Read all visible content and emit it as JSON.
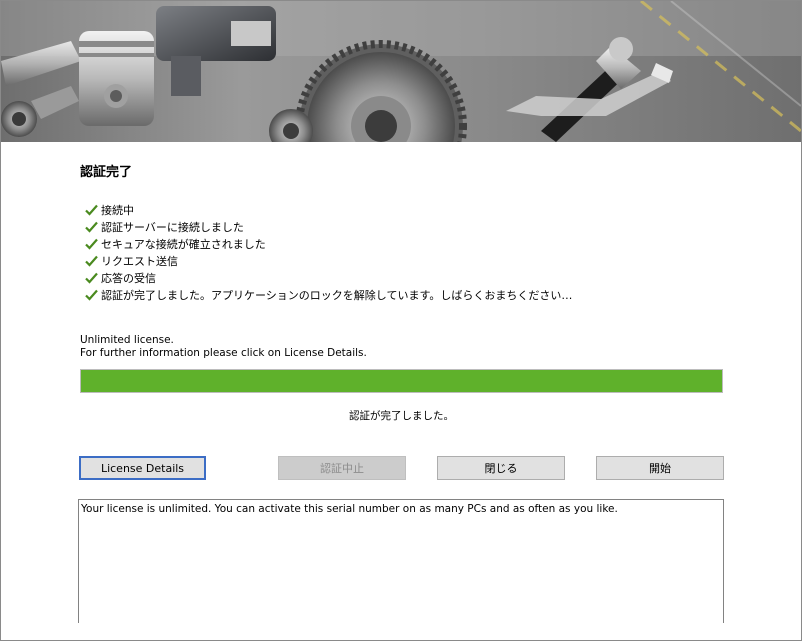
{
  "window": {
    "title": "認証完了"
  },
  "steps": [
    {
      "label": "接続中"
    },
    {
      "label": "認証サーバーに接続しました"
    },
    {
      "label": "セキュアな接続が確立されました"
    },
    {
      "label": "リクエスト送信"
    },
    {
      "label": "応答の受信"
    },
    {
      "label": "認証が完了しました。アプリケーションのロックを解除しています。しばらくおまちください…"
    }
  ],
  "license_info": {
    "line1": "Unlimited license.",
    "line2": "For further information please click on  License Details."
  },
  "progress": {
    "percent": 100,
    "color": "#5fb12b"
  },
  "status_text": "認証が完了しました。",
  "buttons": {
    "license_details": "License Details",
    "cancel_auth": "認証中止",
    "close": "閉じる",
    "start": "開始"
  },
  "details_text": "Your license is unlimited. You can activate this serial number on as many PCs and as often as you like.",
  "icons": {
    "step_check": "check-icon",
    "banner": "engine-parts-banner"
  },
  "colors": {
    "check": "#4a8a1f",
    "focus_border": "#3c6dc5"
  }
}
